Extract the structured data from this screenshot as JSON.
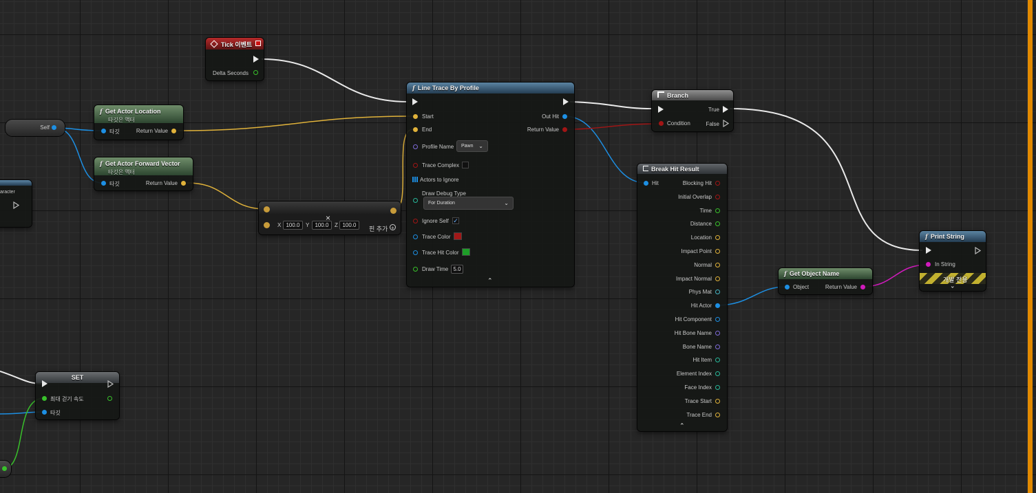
{
  "tick_event": {
    "title": "Tick 이벤트",
    "delta_label": "Delta Seconds"
  },
  "get_actor_location": {
    "title": "Get Actor Location",
    "subtitle": "타깃은 액터",
    "target_label": "타깃",
    "return_label": "Return Value"
  },
  "get_actor_forward": {
    "title": "Get Actor Forward Vector",
    "subtitle": "타깃은 액터",
    "target_label": "타깃",
    "return_label": "Return Value"
  },
  "self_node": {
    "label": "Self"
  },
  "character_node": {
    "label": "aracter"
  },
  "multiply_node": {
    "x_label": "X",
    "x_value": "100.0",
    "y_label": "Y",
    "y_value": "100.0",
    "z_label": "Z",
    "z_value": "100.0",
    "add_pin_label": "핀 추가",
    "close_symbol": "×"
  },
  "line_trace": {
    "title": "Line Trace By Profile",
    "start_label": "Start",
    "end_label": "End",
    "out_hit_label": "Out Hit",
    "return_label": "Return Value",
    "profile_name_label": "Profile Name",
    "profile_value": "Pawn",
    "trace_complex_label": "Trace Complex",
    "actors_ignore_label": "Actors to Ignore",
    "draw_debug_label": "Draw Debug Type",
    "draw_debug_value": "For Duration",
    "ignore_self_label": "Ignore Self",
    "trace_color_label": "Trace Color",
    "trace_color": "#a11818",
    "trace_hit_color_label": "Trace Hit Color",
    "trace_hit_color": "#1e9e28",
    "draw_time_label": "Draw Time",
    "draw_time_value": "5.0"
  },
  "branch": {
    "title": "Branch",
    "condition_label": "Condition",
    "true_label": "True",
    "false_label": "False"
  },
  "break_hit": {
    "title": "Break Hit Result",
    "hit_label": "Hit",
    "outputs": [
      "Blocking Hit",
      "Initial Overlap",
      "Time",
      "Distance",
      "Location",
      "Impact Point",
      "Normal",
      "Impact Normal",
      "Phys Mat",
      "Hit Actor",
      "Hit Component",
      "Hit Bone Name",
      "Bone Name",
      "Hit Item",
      "Element Index",
      "Face Index",
      "Trace Start",
      "Trace End"
    ]
  },
  "get_object_name": {
    "title": "Get Object Name",
    "object_label": "Object",
    "return_label": "Return Value"
  },
  "print_string": {
    "title": "Print String",
    "in_string_label": "In String",
    "dev_only_label": "개발 전용"
  },
  "set_node": {
    "title": "SET",
    "var_label": "최대 걷기 속도",
    "target_label": "타깃"
  },
  "colors": {
    "exec": "#ffffff",
    "vector": "#e0b23a",
    "object": "#1d8fe3",
    "bool": "#a11515",
    "float": "#39c12b",
    "string": "#d11bbd",
    "accent": "#e38a00"
  }
}
